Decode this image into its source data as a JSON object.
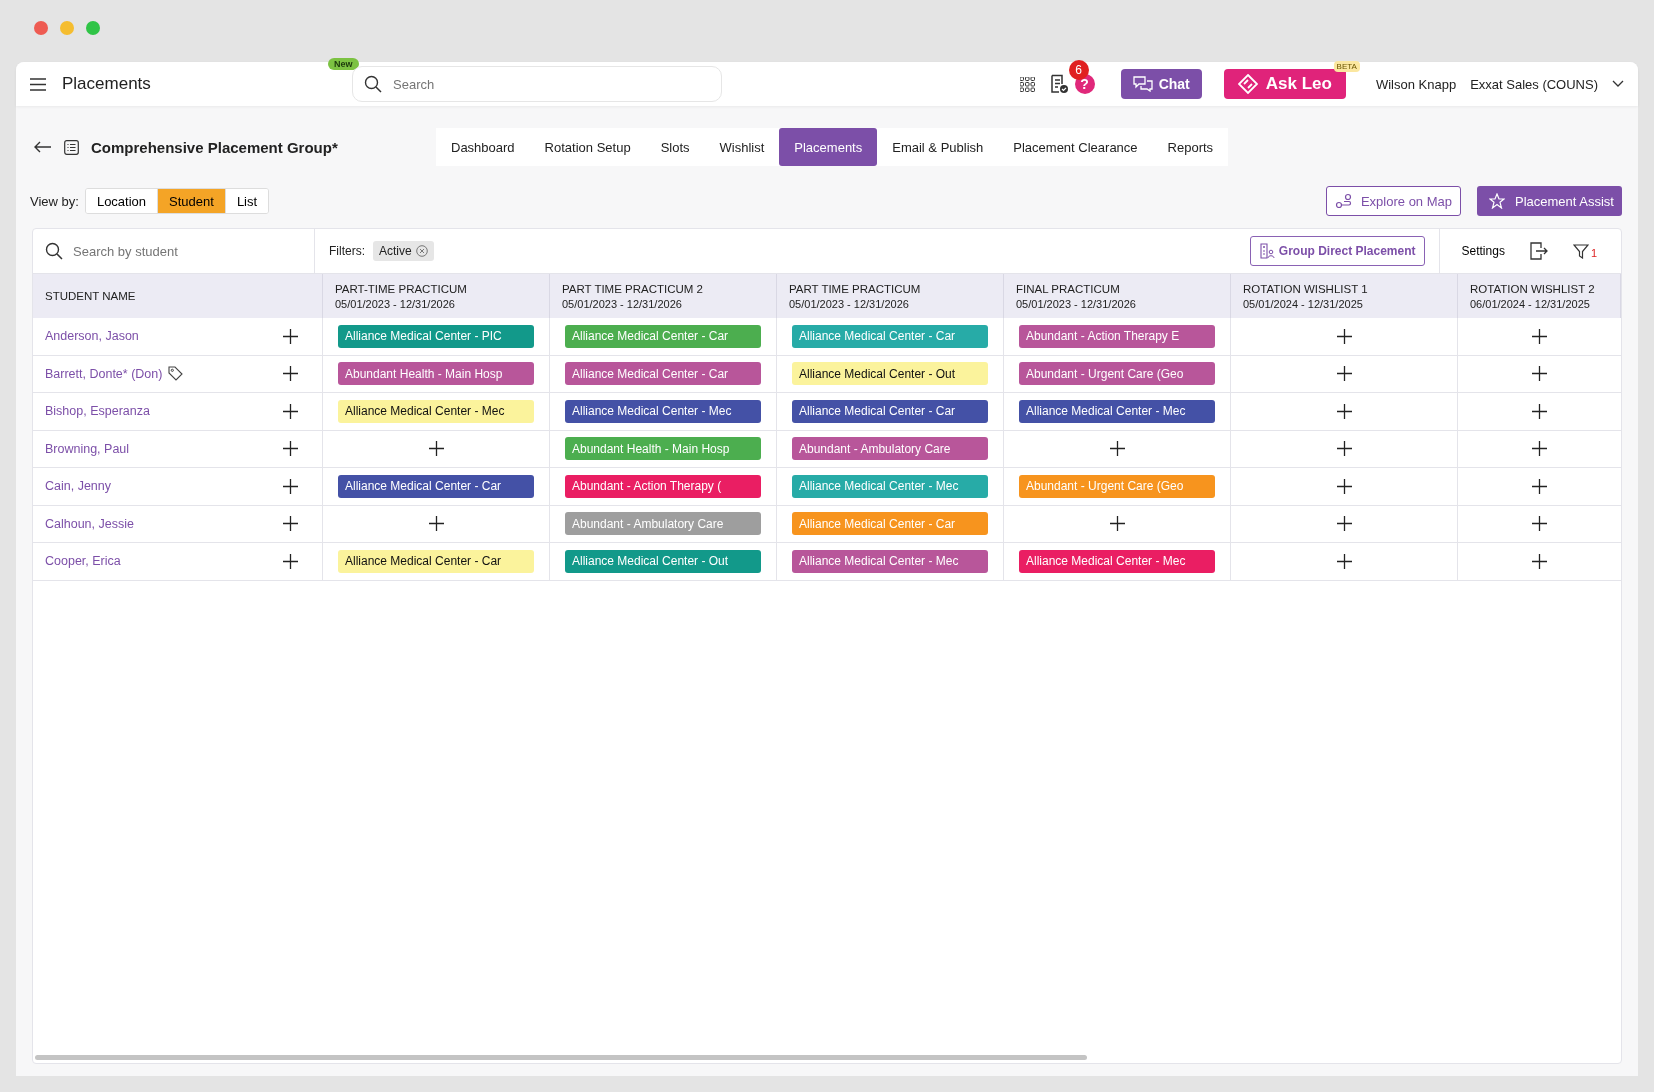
{
  "app_bar": {
    "title": "Placements",
    "new_badge": "New",
    "search": {
      "placeholder": "Search"
    },
    "notification_count": "6",
    "help": "?",
    "chat": "Chat",
    "ask_leo": "Ask Leo",
    "beta": "BETA",
    "user": "Wilson Knapp",
    "org": "Exxat Sales (COUNS)"
  },
  "page": {
    "title": "Comprehensive Placement Group*",
    "tabs": [
      {
        "label": "Dashboard",
        "selected": false
      },
      {
        "label": "Rotation Setup",
        "selected": false
      },
      {
        "label": "Slots",
        "selected": false
      },
      {
        "label": "Wishlist",
        "selected": false
      },
      {
        "label": "Placements",
        "selected": true
      },
      {
        "label": "Email & Publish",
        "selected": false
      },
      {
        "label": "Placement Clearance",
        "selected": false
      },
      {
        "label": "Reports",
        "selected": false
      }
    ]
  },
  "view_by": {
    "label": "View by:",
    "options": [
      {
        "label": "Location",
        "selected": false
      },
      {
        "label": "Student",
        "selected": true
      },
      {
        "label": "List",
        "selected": false
      }
    ]
  },
  "actions": {
    "explore": "Explore on Map",
    "assist": "Placement Assist"
  },
  "toolbar": {
    "search": {
      "placeholder": "Search by student"
    },
    "filters_label": "Filters:",
    "filters": [
      "Active"
    ],
    "group_direct": "Group Direct Placement",
    "settings": "Settings",
    "filter_count": "1"
  },
  "table": {
    "first_column": "STUDENT NAME",
    "columns": [
      {
        "title": "PART-TIME PRACTICUM",
        "dates": "05/01/2023 - 12/31/2026"
      },
      {
        "title": "PART TIME PRACTICUM 2",
        "dates": "05/01/2023 - 12/31/2026"
      },
      {
        "title": "PART TIME PRACTICUM",
        "dates": "05/01/2023 - 12/31/2026"
      },
      {
        "title": "FINAL PRACTICUM",
        "dates": "05/01/2023 - 12/31/2026"
      },
      {
        "title": "ROTATION WISHLIST 1",
        "dates": "05/01/2024 - 12/31/2025"
      },
      {
        "title": "ROTATION WISHLIST 2",
        "dates": "06/01/2024 - 12/31/2025"
      }
    ],
    "rows": [
      {
        "name": "Anderson, Jason",
        "tagged": false,
        "cells": [
          {
            "kind": "placement",
            "text": "Alliance Medical Center - PIC",
            "color": "#12998a"
          },
          {
            "kind": "placement",
            "text": "Alliance Medical Center - Car",
            "color": "#4cae4f"
          },
          {
            "kind": "placement",
            "text": "Alliance Medical Center - Car",
            "color": "#27aba7"
          },
          {
            "kind": "placement",
            "text": "Abundant - Action Therapy E",
            "color": "#b8569a"
          },
          {
            "kind": "add"
          },
          {
            "kind": "add"
          }
        ]
      },
      {
        "name": "Barrett, Donte* (Don)",
        "tagged": true,
        "cells": [
          {
            "kind": "placement",
            "text": "Abundant Health - Main Hosp",
            "color": "#b8569a"
          },
          {
            "kind": "placement",
            "text": "Alliance Medical Center - Car",
            "color": "#b8569a"
          },
          {
            "kind": "placement",
            "text": "Alliance Medical Center - Out",
            "color": "#fbf39c"
          },
          {
            "kind": "placement",
            "text": "Abundant - Urgent Care (Geo",
            "color": "#b8569a"
          },
          {
            "kind": "add"
          },
          {
            "kind": "add"
          }
        ]
      },
      {
        "name": "Bishop, Esperanza",
        "tagged": false,
        "cells": [
          {
            "kind": "placement",
            "text": "Alliance Medical Center - Mec",
            "color": "#fbf39c"
          },
          {
            "kind": "placement",
            "text": "Alliance Medical Center - Mec",
            "color": "#4451a6"
          },
          {
            "kind": "placement",
            "text": "Alliance Medical Center - Car",
            "color": "#4451a6"
          },
          {
            "kind": "placement",
            "text": "Alliance Medical Center - Mec",
            "color": "#4451a6"
          },
          {
            "kind": "add"
          },
          {
            "kind": "add"
          }
        ]
      },
      {
        "name": "Browning, Paul",
        "tagged": false,
        "cells": [
          {
            "kind": "add"
          },
          {
            "kind": "placement",
            "text": "Abundant Health - Main Hosp",
            "color": "#4cae4f"
          },
          {
            "kind": "placement",
            "text": "Abundant - Ambulatory Care",
            "color": "#b8569a"
          },
          {
            "kind": "add"
          },
          {
            "kind": "add"
          },
          {
            "kind": "add"
          }
        ]
      },
      {
        "name": "Cain, Jenny",
        "tagged": false,
        "cells": [
          {
            "kind": "placement",
            "text": "Alliance Medical Center - Car",
            "color": "#4451a6"
          },
          {
            "kind": "placement",
            "text": "Abundant - Action Therapy (",
            "color": "#ea1e63"
          },
          {
            "kind": "placement",
            "text": "Alliance Medical Center - Mec",
            "color": "#27aba7"
          },
          {
            "kind": "placement",
            "text": "Abundant - Urgent Care (Geo",
            "color": "#f7941e"
          },
          {
            "kind": "add"
          },
          {
            "kind": "add"
          }
        ]
      },
      {
        "name": "Calhoun, Jessie",
        "tagged": false,
        "cells": [
          {
            "kind": "add"
          },
          {
            "kind": "placement",
            "text": "Abundant - Ambulatory Care",
            "color": "#9e9e9e"
          },
          {
            "kind": "placement",
            "text": "Alliance Medical Center - Car",
            "color": "#f7941e"
          },
          {
            "kind": "add"
          },
          {
            "kind": "add"
          },
          {
            "kind": "add"
          }
        ]
      },
      {
        "name": "Cooper, Erica",
        "tagged": false,
        "cells": [
          {
            "kind": "placement",
            "text": "Alliance Medical Center - Car",
            "color": "#fbf39c"
          },
          {
            "kind": "placement",
            "text": "Alliance Medical Center - Out",
            "color": "#12998a"
          },
          {
            "kind": "placement",
            "text": "Alliance Medical Center - Mec",
            "color": "#b8569a"
          },
          {
            "kind": "placement",
            "text": "Alliance Medical Center - Mec",
            "color": "#ea1e63"
          },
          {
            "kind": "add"
          },
          {
            "kind": "add"
          }
        ]
      }
    ]
  }
}
